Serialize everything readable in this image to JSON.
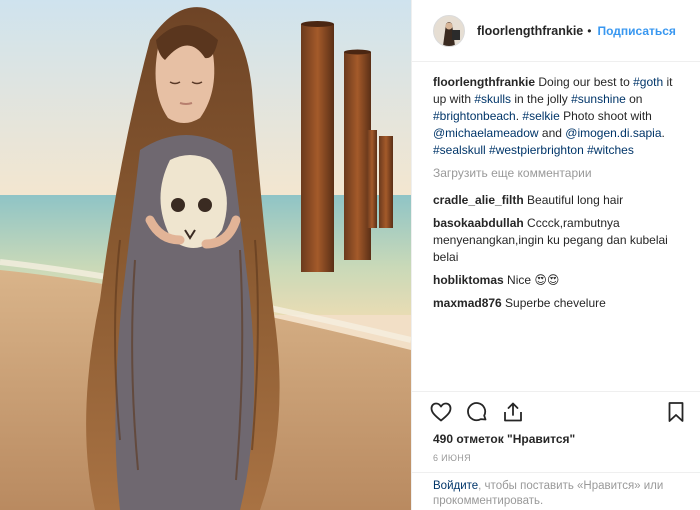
{
  "post": {
    "username": "floorlengthfrankie",
    "separator": "•",
    "follow_label": "Подписаться",
    "caption": {
      "username": "floorlengthfrankie",
      "parts": [
        {
          "t": "Doing our best to ",
          "tag": false
        },
        {
          "t": "#goth",
          "tag": true
        },
        {
          "t": " it up with ",
          "tag": false
        },
        {
          "t": "#skulls",
          "tag": true
        },
        {
          "t": " in the jolly ",
          "tag": false
        },
        {
          "t": "#sunshine",
          "tag": true
        },
        {
          "t": " on ",
          "tag": false
        },
        {
          "t": "#brightonbeach",
          "tag": true
        },
        {
          "t": ". ",
          "tag": false
        },
        {
          "t": "#selkie",
          "tag": true
        },
        {
          "t": " Photo shoot with ",
          "tag": false
        },
        {
          "t": "@michaelameadow",
          "tag": true
        },
        {
          "t": " and ",
          "tag": false
        },
        {
          "t": "@imogen.di.sapia",
          "tag": true
        },
        {
          "t": ". ",
          "tag": false
        },
        {
          "t": "#sealskull",
          "tag": true
        },
        {
          "t": " ",
          "tag": false
        },
        {
          "t": "#westpierbrighton",
          "tag": true
        },
        {
          "t": " ",
          "tag": false
        },
        {
          "t": "#witches",
          "tag": true
        }
      ]
    },
    "load_more_label": "Загрузить еще комментарии",
    "comments": [
      {
        "user": "cradle_alie_filth",
        "text": "Beautiful long hair"
      },
      {
        "user": "basokaabdullah",
        "text": "Cccck,rambutnya menyenangkan,ingin ku pegang dan kubelai belai"
      },
      {
        "user": "hobliktomas",
        "text": "Nice 😍😍"
      },
      {
        "user": "maxmad876",
        "text": "Superbe chevelure"
      }
    ],
    "likes": "490 отметок \"Нравится\"",
    "date": "6 ИЮНЯ",
    "login": {
      "link": "Войдите",
      "rest": ", чтобы поставить «Нравится» или прокомментировать."
    },
    "icons": {
      "like": "heart-icon",
      "comment": "comment-icon",
      "share": "share-icon",
      "save": "bookmark-icon"
    }
  }
}
